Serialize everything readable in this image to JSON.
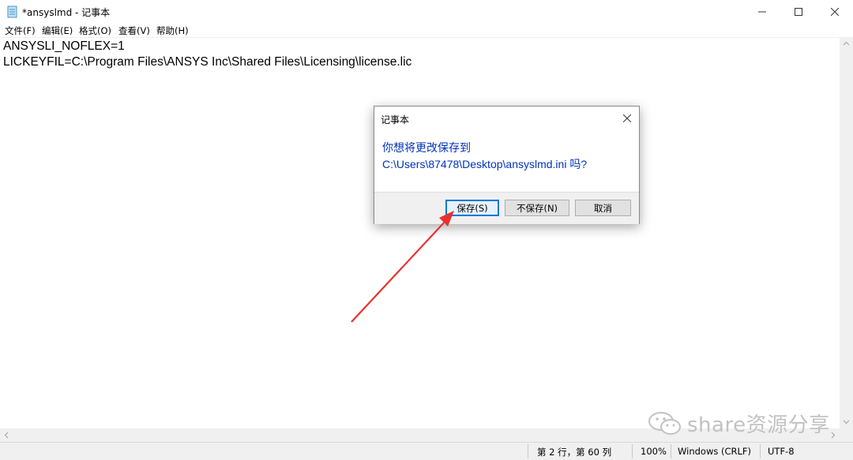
{
  "window": {
    "title": "*ansyslmd - 记事本",
    "icon": "notepad-icon"
  },
  "menu": [
    {
      "label": "文件(F)"
    },
    {
      "label": "编辑(E)"
    },
    {
      "label": "格式(O)"
    },
    {
      "label": "查看(V)"
    },
    {
      "label": "帮助(H)"
    }
  ],
  "editor": {
    "lines": [
      "ANSYSLI_NOFLEX=1",
      "LICKEYFIL=C:\\Program Files\\ANSYS Inc\\Shared Files\\Licensing\\license.lic"
    ]
  },
  "status": {
    "position": "第 2 行，第 60 列",
    "zoom": "100%",
    "line_ending": "Windows (CRLF)",
    "encoding": "UTF-8"
  },
  "dialog": {
    "title": "记事本",
    "message_line1": "你想将更改保存到",
    "message_line2": "C:\\Users\\87478\\Desktop\\ansyslmd.ini 吗?",
    "save_label": "保存(S)",
    "dont_save_label": "不保存(N)",
    "cancel_label": "取消"
  },
  "watermark": {
    "text": "share资源分享"
  },
  "colors": {
    "dialog_message": "#0033bc",
    "default_button_border": "#0078d7",
    "arrow": "#e8312f"
  }
}
